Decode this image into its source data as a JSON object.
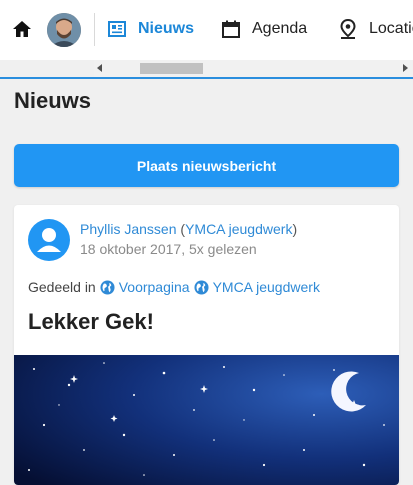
{
  "nav": {
    "items": [
      {
        "label": "Nieuws",
        "icon": "newspaper-icon",
        "active": true
      },
      {
        "label": "Agenda",
        "icon": "calendar-icon",
        "active": false
      },
      {
        "label": "Locaties",
        "icon": "location-pin-icon",
        "active": false
      }
    ]
  },
  "page": {
    "title": "Nieuws"
  },
  "actions": {
    "post_button": "Plaats nieuwsbericht"
  },
  "post": {
    "author": "Phyllis Janssen",
    "group": "YMCA jeugdwerk",
    "date": "18 oktober 2017",
    "views": "5x gelezen",
    "shared_prefix": "Gedeeld in",
    "shared_in": [
      "Voorpagina",
      "YMCA jeugdwerk"
    ],
    "title": "Lekker Gek!"
  },
  "colors": {
    "accent": "#2196f3",
    "link": "#2f8ad6",
    "active_nav": "#1c87d8"
  }
}
